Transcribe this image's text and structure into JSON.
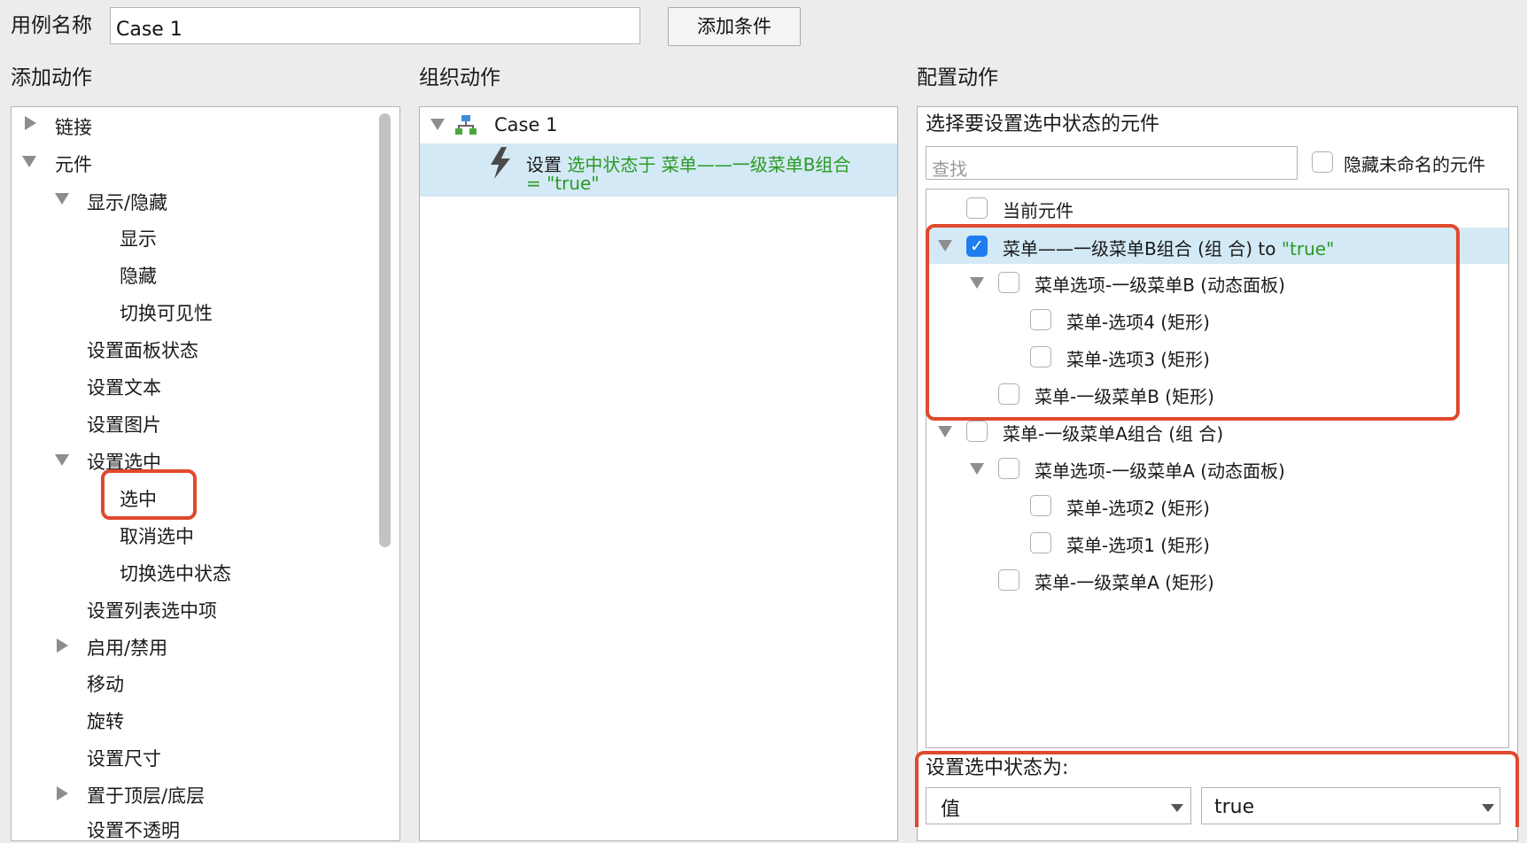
{
  "top": {
    "case_name_label": "用例名称",
    "case_name_value": "Case 1",
    "add_condition_label": "添加条件"
  },
  "add_actions": {
    "title": "添加动作",
    "items": [
      {
        "label": "链接",
        "state": "collapsed"
      },
      {
        "label": "元件",
        "state": "expanded"
      },
      {
        "label": "显示/隐藏",
        "state": "expanded"
      },
      {
        "label": "显示"
      },
      {
        "label": "隐藏"
      },
      {
        "label": "切换可见性"
      },
      {
        "label": "设置面板状态"
      },
      {
        "label": "设置文本"
      },
      {
        "label": "设置图片"
      },
      {
        "label": "设置选中",
        "state": "expanded"
      },
      {
        "label": "选中",
        "highlighted": true
      },
      {
        "label": "取消选中"
      },
      {
        "label": "切换选中状态"
      },
      {
        "label": "设置列表选中项"
      },
      {
        "label": "启用/禁用",
        "state": "collapsed"
      },
      {
        "label": "移动"
      },
      {
        "label": "旋转"
      },
      {
        "label": "设置尺寸"
      },
      {
        "label": "置于顶层/底层",
        "state": "collapsed"
      },
      {
        "label": "设置不透明"
      }
    ]
  },
  "organize": {
    "title": "组织动作",
    "case_label": "Case 1",
    "action_prefix": "设置",
    "action_detail_1": "选中状态于 菜单——一级菜单B组合",
    "action_detail_2": "= \"true\""
  },
  "configure": {
    "title": "配置动作",
    "subtitle": "选择要设置选中状态的元件",
    "search_placeholder": "查找",
    "hide_unnamed_label": "隐藏未命名的元件",
    "widgets": [
      {
        "name": "当前元件",
        "checked": false
      },
      {
        "name": "菜单——一级菜单B组合 (组 合) to ",
        "value": "\"true\"",
        "checked": true,
        "expanded": true
      },
      {
        "name": "菜单选项-一级菜单B (动态面板)",
        "checked": false,
        "expanded": true
      },
      {
        "name": "菜单-选项4 (矩形)",
        "checked": false
      },
      {
        "name": "菜单-选项3 (矩形)",
        "checked": false
      },
      {
        "name": "菜单-一级菜单B (矩形)",
        "checked": false
      },
      {
        "name": "菜单-一级菜单A组合 (组 合)",
        "checked": false,
        "expanded": true
      },
      {
        "name": "菜单选项-一级菜单A (动态面板)",
        "checked": false,
        "expanded": true
      },
      {
        "name": "菜单-选项2 (矩形)",
        "checked": false
      },
      {
        "name": "菜单-选项1 (矩形)",
        "checked": false
      },
      {
        "name": "菜单-一级菜单A (矩形)",
        "checked": false
      }
    ],
    "set_state_label": "设置选中状态为:",
    "value_type": "值",
    "value": "true"
  },
  "colors": {
    "highlight_red": "#e0492d",
    "selection_blue": "#d3e9f5",
    "action_green": "#2b9a24",
    "checkbox_blue": "#1f7cf0"
  }
}
